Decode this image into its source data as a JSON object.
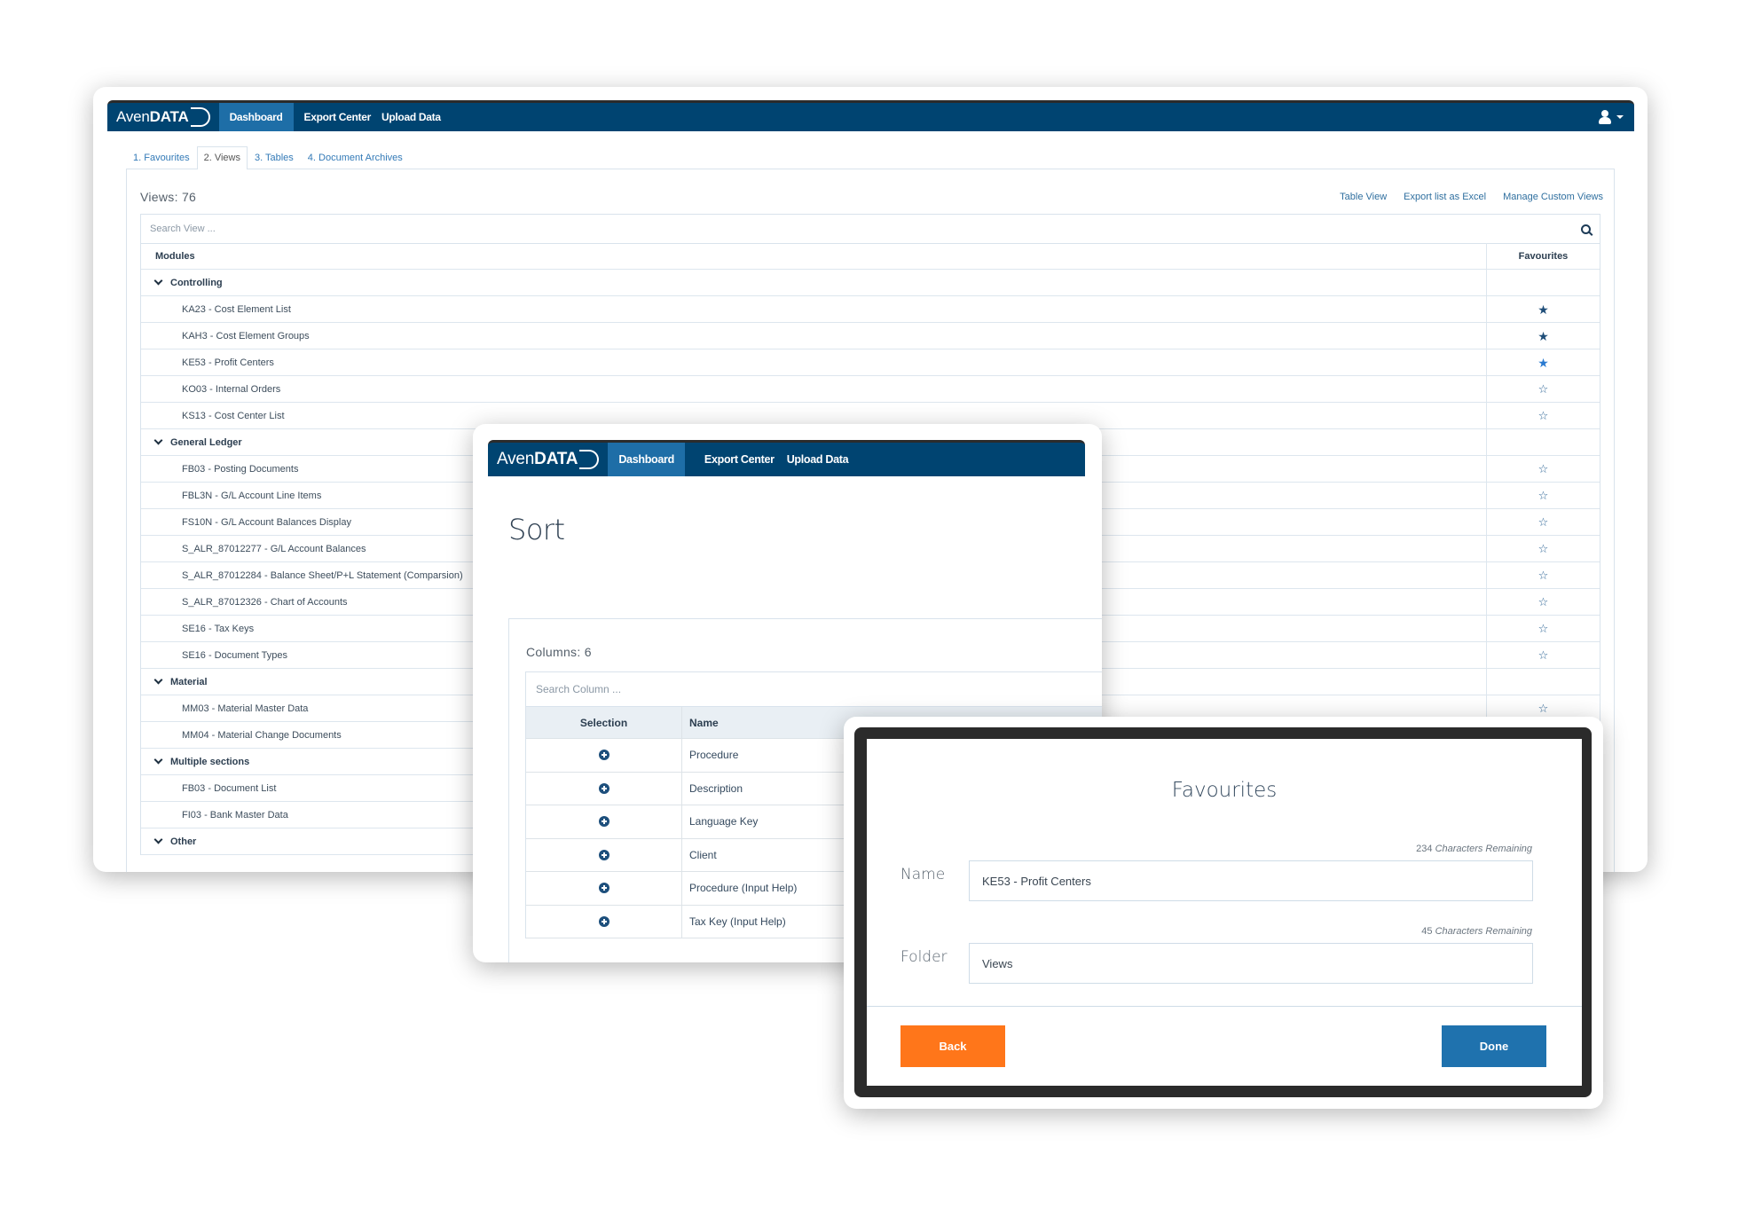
{
  "app": {
    "brand_light": "Aven",
    "brand_bold": "DATA",
    "nav": [
      "Dashboard",
      "Export Center",
      "Upload Data"
    ],
    "active_nav": "Dashboard"
  },
  "colors": {
    "navbar": "#004471",
    "nav_active": "#1e6ea7",
    "link": "#2f6f9f",
    "back_button": "#ff761a",
    "done_button": "#1f72ae"
  },
  "main": {
    "tabs": [
      "1. Favourites",
      "2. Views",
      "3. Tables",
      "4. Document Archives"
    ],
    "active_tab": "2. Views",
    "views_count": "Views: 76",
    "links": [
      "Table View",
      "Export list as Excel",
      "Manage Custom Views"
    ],
    "search_placeholder": "Search View ...",
    "columns": [
      "Modules",
      "Favourites"
    ],
    "groups": [
      {
        "name": "Controlling",
        "items": [
          {
            "label": "KA23 - Cost Element List",
            "favourite": true
          },
          {
            "label": "KAH3 - Cost Element Groups",
            "favourite": true
          },
          {
            "label": "KE53 - Profit Centers",
            "favourite": true,
            "highlighted": true
          },
          {
            "label": "KO03 - Internal Orders",
            "favourite": false
          },
          {
            "label": "KS13 - Cost Center List",
            "favourite": false
          }
        ]
      },
      {
        "name": "General Ledger",
        "items": [
          {
            "label": "FB03 - Posting Documents",
            "favourite": false
          },
          {
            "label": "FBL3N - G/L Account Line Items",
            "favourite": false
          },
          {
            "label": "FS10N - G/L Account Balances Display",
            "favourite": false
          },
          {
            "label": "S_ALR_87012277 - G/L Account Balances",
            "favourite": false
          },
          {
            "label": "S_ALR_87012284 - Balance Sheet/P+L Statement (Comparsion)",
            "favourite": false
          },
          {
            "label": "S_ALR_87012326 - Chart of Accounts",
            "favourite": false
          },
          {
            "label": "SE16 - Tax Keys",
            "favourite": false
          },
          {
            "label": "SE16 - Document Types",
            "favourite": false
          }
        ]
      },
      {
        "name": "Material",
        "items": [
          {
            "label": "MM03 - Material Master Data",
            "favourite": false
          },
          {
            "label": "MM04 - Material Change Documents",
            "favourite": false
          }
        ]
      },
      {
        "name": "Multiple sections",
        "items": [
          {
            "label": "FB03 - Document List",
            "favourite": false
          },
          {
            "label": "FI03 - Bank Master Data",
            "favourite": false
          }
        ]
      },
      {
        "name": "Other",
        "items": []
      }
    ]
  },
  "sort": {
    "title": "Sort",
    "columns_count": "Columns: 6",
    "search_placeholder": "Search Column ...",
    "headers": [
      "Selection",
      "Name"
    ],
    "rows": [
      "Procedure",
      "Description",
      "Language Key",
      "Client",
      "Procedure (Input Help)",
      "Tax Key (Input Help)"
    ]
  },
  "favourites_dialog": {
    "title": "Favourites",
    "name_label": "Name",
    "name_value": "KE53 - Profit Centers",
    "name_remaining_count": "234",
    "folder_label": "Folder",
    "folder_value": "Views",
    "folder_remaining_count": "45",
    "remaining_suffix": "Characters Remaining",
    "back_label": "Back",
    "done_label": "Done"
  }
}
